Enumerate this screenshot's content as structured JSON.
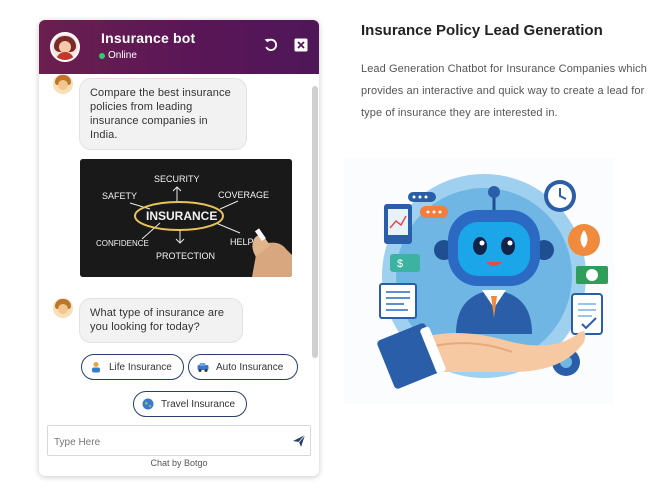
{
  "chat": {
    "bot_name": "Insurance bot",
    "status": "Online",
    "messages": [
      "Compare the best insurance policies from leading insurance companies in India.",
      "What type of insurance are you looking for today?"
    ],
    "image_words": [
      "SECURITY",
      "SAFETY",
      "COVERAGE",
      "INSURANCE",
      "CONFIDENCE",
      "PROTECTION",
      "HELP"
    ],
    "options": [
      "Life Insurance",
      "Auto Insurance",
      "Travel Insurance"
    ],
    "input_placeholder": "Type Here",
    "footer": "Chat by Botgo"
  },
  "page": {
    "title": "Insurance Policy Lead Generation",
    "description": "Lead Generation Chatbot for Insurance Companies which provides an interactive and quick way to create a lead for type of insurance they are interested in."
  },
  "colors": {
    "header": "#5a1657",
    "option_border": "#2a3e6b",
    "online": "#2ecc71"
  },
  "icons": [
    "refresh-icon",
    "close-icon",
    "send-icon",
    "life-icon",
    "car-icon",
    "globe-icon"
  ]
}
